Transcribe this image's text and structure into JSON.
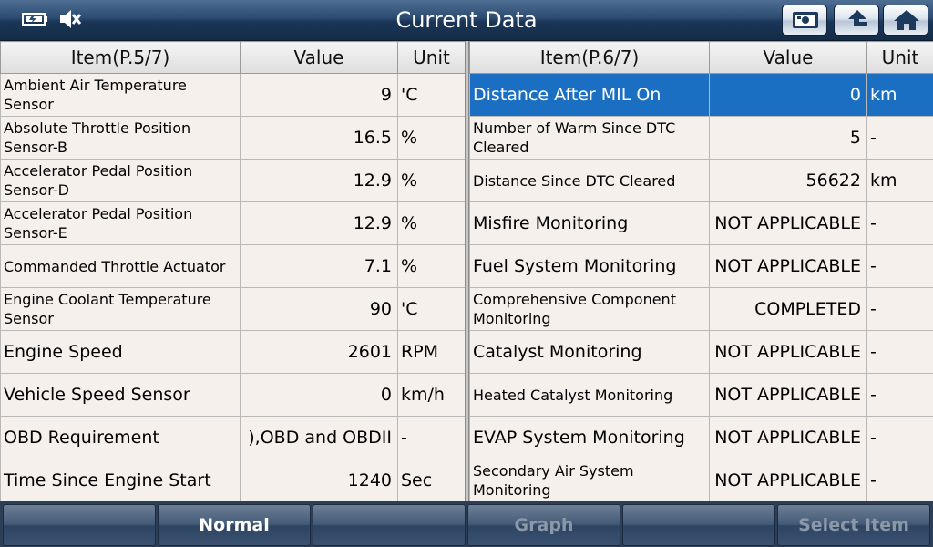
{
  "header": {
    "title": "Current Data",
    "icons": [
      "battery-icon",
      "mute-speaker-icon",
      "record-icon",
      "back-icon",
      "home-icon"
    ]
  },
  "left_table": {
    "headers": [
      "Item(P.5/7)",
      "Value",
      "Unit"
    ],
    "rows": [
      {
        "item": "Ambient Air Temperature Sensor",
        "value": "9",
        "unit": "'C"
      },
      {
        "item": "Absolute Throttle Position Sensor-B",
        "value": "16.5",
        "unit": "%"
      },
      {
        "item": "Accelerator Pedal Position Sensor-D",
        "value": "12.9",
        "unit": "%"
      },
      {
        "item": "Accelerator Pedal Position Sensor-E",
        "value": "12.9",
        "unit": "%"
      },
      {
        "item": "Commanded Throttle Actuator",
        "value": "7.1",
        "unit": "%"
      },
      {
        "item": "Engine Coolant Temperature Sensor",
        "value": "90",
        "unit": "'C"
      },
      {
        "item": "Engine Speed",
        "value": "2601",
        "unit": "RPM"
      },
      {
        "item": "Vehicle Speed Sensor",
        "value": "0",
        "unit": "km/h"
      },
      {
        "item": "OBD Requirement",
        "value": "),OBD and OBDII",
        "unit": "-"
      },
      {
        "item": "Time Since Engine Start",
        "value": "1240",
        "unit": "Sec"
      }
    ]
  },
  "right_table": {
    "headers": [
      "Item(P.6/7)",
      "Value",
      "Unit"
    ],
    "rows": [
      {
        "item": "Distance After MIL On",
        "value": "0",
        "unit": "km",
        "selected": true
      },
      {
        "item": "Number of Warm Since DTC Cleared",
        "value": "5",
        "unit": "-"
      },
      {
        "item": "Distance Since DTC Cleared",
        "value": "56622",
        "unit": "km"
      },
      {
        "item": "Misfire Monitoring",
        "value": "NOT APPLICABLE",
        "unit": "-"
      },
      {
        "item": "Fuel System Monitoring",
        "value": "NOT APPLICABLE",
        "unit": "-"
      },
      {
        "item": "Comprehensive Component Monitoring",
        "value": "COMPLETED",
        "unit": "-"
      },
      {
        "item": "Catalyst Monitoring",
        "value": "NOT APPLICABLE",
        "unit": "-"
      },
      {
        "item": "Heated Catalyst Monitoring",
        "value": "NOT APPLICABLE",
        "unit": "-"
      },
      {
        "item": "EVAP System Monitoring",
        "value": "NOT APPLICABLE",
        "unit": "-"
      },
      {
        "item": "Secondary Air System Monitoring",
        "value": "NOT APPLICABLE",
        "unit": "-"
      }
    ]
  },
  "bottom_bar": {
    "buttons": [
      {
        "label": "",
        "state": "disabled"
      },
      {
        "label": "Normal",
        "state": "active"
      },
      {
        "label": "",
        "state": "disabled"
      },
      {
        "label": "Graph",
        "state": "disabled"
      },
      {
        "label": "",
        "state": "disabled"
      },
      {
        "label": "Select Item",
        "state": "disabled"
      }
    ]
  },
  "colors": {
    "header_bg": "#1a3556",
    "selected_row": "#1b6fc2",
    "table_bg": "#f6f0ed"
  }
}
